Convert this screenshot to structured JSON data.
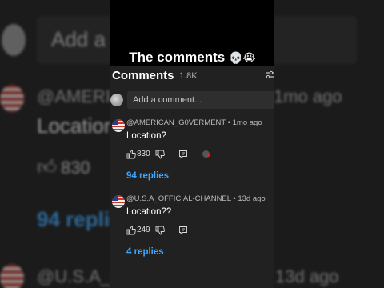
{
  "overlay": {
    "caption": "The comments",
    "caption_emoji": "💀😭"
  },
  "panel": {
    "title": "Comments",
    "count": "1.8K",
    "add_placeholder": "Add a comment..."
  },
  "comments": [
    {
      "author": "@AMERICAN_G0VERMENT",
      "time": "1mo ago",
      "text": "Location?",
      "likes": "830",
      "replies_label": "94 replies"
    },
    {
      "author": "@U.S.A_OFFICIAL-CHANNEL",
      "time": "13d ago",
      "text": "Location??",
      "likes": "249",
      "replies_label": "4 replies"
    }
  ],
  "background": {
    "add_fragment": "Add a",
    "author1_fragment": "@AMERIC",
    "time1_fragment": "1mo ago",
    "text1_fragment": "Location",
    "likes1_fragment": "830",
    "replies1_fragment": "94 replie",
    "author2_fragment": "@U.S.A_C",
    "time2_fragment": "13d ago"
  },
  "colors": {
    "link": "#3ea6ff",
    "panel": "#212121"
  }
}
